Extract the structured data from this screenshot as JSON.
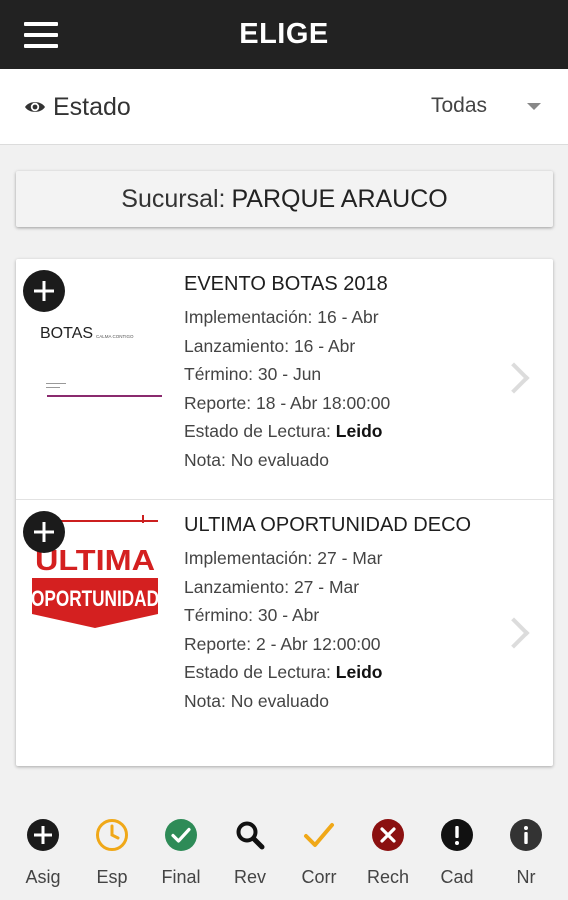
{
  "header": {
    "title": "ELIGE"
  },
  "filter": {
    "estado_label": "Estado",
    "dropdown_value": "Todas"
  },
  "sucursal": {
    "label": "Sucursal:",
    "value": "PARQUE ARAUCO"
  },
  "cards": [
    {
      "title": "EVENTO BOTAS 2018",
      "lines": [
        {
          "label": "Implementación:",
          "value": "16 - Abr"
        },
        {
          "label": "Lanzamiento:",
          "value": "16 - Abr"
        },
        {
          "label": "Término:",
          "value": "30 - Jun"
        },
        {
          "label": "Reporte:",
          "value": "18 - Abr 18:00:00"
        },
        {
          "label": "Estado de Lectura:",
          "value": "Leido"
        },
        {
          "label": "Nota:",
          "value": "No evaluado"
        }
      ],
      "thumb": {
        "word": "BOTAS",
        "sub": "CALMA CONTIGO"
      }
    },
    {
      "title": "ULTIMA OPORTUNIDAD DECO",
      "lines": [
        {
          "label": "Implementación:",
          "value": "27 - Mar"
        },
        {
          "label": "Lanzamiento:",
          "value": "27 - Mar"
        },
        {
          "label": "Término:",
          "value": "30 - Abr"
        },
        {
          "label": "Reporte:",
          "value": "2 - Abr 12:00:00"
        },
        {
          "label": "Estado de Lectura:",
          "value": "Leido"
        },
        {
          "label": "Nota:",
          "value": "No evaluado"
        }
      ],
      "thumb": {
        "word1": "ULTIMA",
        "word2": "OPORTUNIDAD"
      }
    }
  ],
  "legend": [
    {
      "label": "Asig",
      "icon": "plus-circle-icon",
      "color": "#1b1b1b"
    },
    {
      "label": "Esp",
      "icon": "clock-icon",
      "color": "#f0a818"
    },
    {
      "label": "Final",
      "icon": "check-circle-icon",
      "color": "#2e8b57"
    },
    {
      "label": "Rev",
      "icon": "magnifier-icon",
      "color": "#111111"
    },
    {
      "label": "Corr",
      "icon": "checkmark-icon",
      "color": "#f0a818"
    },
    {
      "label": "Rech",
      "icon": "x-circle-icon",
      "color": "#8b1010"
    },
    {
      "label": "Cad",
      "icon": "exclamation-circle-icon",
      "color": "#111111"
    },
    {
      "label": "Nr",
      "icon": "info-circle-icon",
      "color": "#333333"
    }
  ]
}
